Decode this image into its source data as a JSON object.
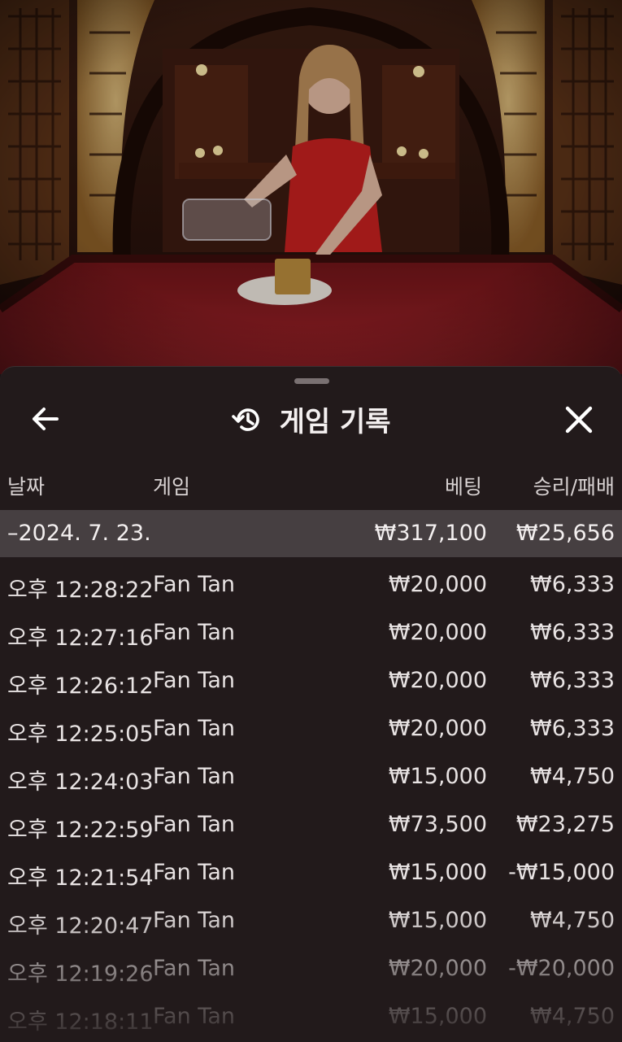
{
  "header": {
    "title": "게임 기록",
    "back_icon": "arrow-left-icon",
    "history_icon": "history-icon",
    "close_icon": "close-icon"
  },
  "columns": {
    "date": "날짜",
    "game": "게임",
    "bet": "베팅",
    "win_loss": "승리/패배"
  },
  "summary": {
    "date": "–2024. 7. 23.",
    "bet": "₩317,100",
    "win_loss": "₩25,656"
  },
  "rows": [
    {
      "time": "오후 12:28:22",
      "game": "Fan Tan",
      "bet": "₩20,000",
      "win_loss": "₩6,333"
    },
    {
      "time": "오후 12:27:16",
      "game": "Fan Tan",
      "bet": "₩20,000",
      "win_loss": "₩6,333"
    },
    {
      "time": "오후 12:26:12",
      "game": "Fan Tan",
      "bet": "₩20,000",
      "win_loss": "₩6,333"
    },
    {
      "time": "오후 12:25:05",
      "game": "Fan Tan",
      "bet": "₩20,000",
      "win_loss": "₩6,333"
    },
    {
      "time": "오후 12:24:03",
      "game": "Fan Tan",
      "bet": "₩15,000",
      "win_loss": "₩4,750"
    },
    {
      "time": "오후 12:22:59",
      "game": "Fan Tan",
      "bet": "₩73,500",
      "win_loss": "₩23,275"
    },
    {
      "time": "오후 12:21:54",
      "game": "Fan Tan",
      "bet": "₩15,000",
      "win_loss": "-₩15,000"
    },
    {
      "time": "오후 12:20:47",
      "game": "Fan Tan",
      "bet": "₩15,000",
      "win_loss": "₩4,750"
    },
    {
      "time": "오후 12:19:26",
      "game": "Fan Tan",
      "bet": "₩20,000",
      "win_loss": "-₩20,000"
    },
    {
      "time": "오후 12:18:11",
      "game": "Fan Tan",
      "bet": "₩15,000",
      "win_loss": "₩4,750"
    }
  ],
  "colors": {
    "sheet_bg": "#221a1b",
    "summary_bg": "#463f41",
    "text": "#e8e3e3",
    "table_felt": "#8e1c1f",
    "dealer_dress": "#c4201f"
  }
}
